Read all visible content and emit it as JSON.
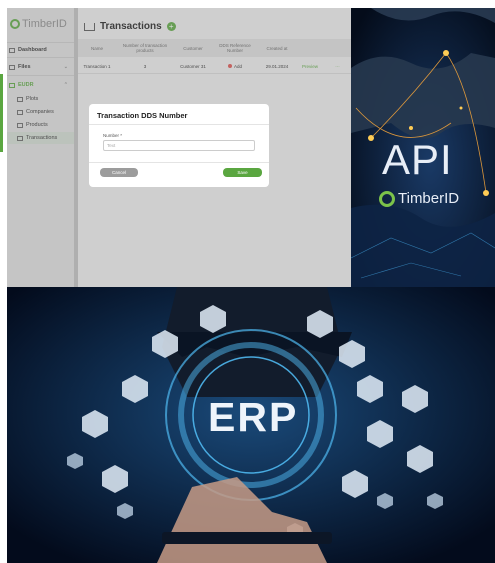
{
  "app": {
    "logo_text": "TimberID",
    "sidebar": [
      {
        "label": "Dashboard"
      },
      {
        "label": "Files"
      },
      {
        "label": "EUDR"
      },
      {
        "label": "Plots"
      },
      {
        "label": "Companies"
      },
      {
        "label": "Products"
      },
      {
        "label": "Transactions"
      }
    ],
    "page_title": "Transactions",
    "table": {
      "headers": [
        "Name",
        "Number of transaction products",
        "Customer",
        "DDS Reference Number",
        "Created at",
        "",
        ""
      ],
      "rows": [
        [
          "Transaction 1",
          "3",
          "Customer 31",
          "Add",
          "29.01.2024",
          "Preview",
          "···"
        ]
      ]
    },
    "modal": {
      "title": "Transaction DDS Number",
      "field_label": "Number *",
      "field_placeholder": "Text",
      "cancel_label": "Cancel",
      "save_label": "Save"
    }
  },
  "api_banner": {
    "text": "API",
    "brand": "TimberID"
  },
  "erp_banner": {
    "text": "ERP"
  },
  "colors": {
    "brand_green": "#5aa640",
    "status_red": "#d9534f"
  }
}
